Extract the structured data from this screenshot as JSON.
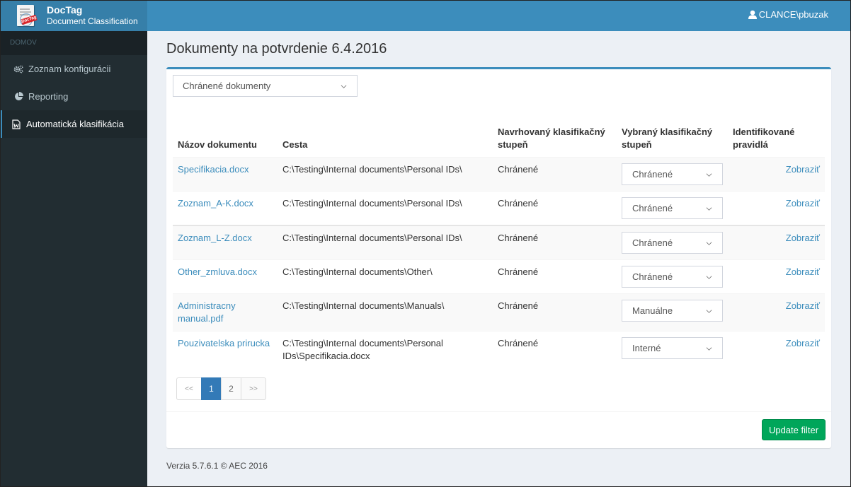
{
  "app": {
    "brand": "DocTag",
    "subtitle": "Document Classification",
    "logo_stamp": "DocTag"
  },
  "header": {
    "user": "CLANCE\\pbuzak",
    "user_icon": "user-icon"
  },
  "sidebar": {
    "section": "DOMOV",
    "items": [
      {
        "label": "Zoznam konfigurácii",
        "icon": "gears-icon",
        "active": false
      },
      {
        "label": "Reporting",
        "icon": "pie-chart-icon",
        "active": false
      },
      {
        "label": "Automatická klasifikácia",
        "icon": "word-file-icon",
        "active": true
      }
    ]
  },
  "page": {
    "title": "Dokumenty na potvrdenie 6.4.2016"
  },
  "filter": {
    "selected": "Chránené dokumenty"
  },
  "table": {
    "headers": {
      "name": "Názov dokumentu",
      "path": "Cesta",
      "proposed_line1": "Navrhovaný klasifikačný",
      "proposed_line2": "stupeň",
      "selected_line1": "Vybraný klasifikačný",
      "selected_line2": "stupeň",
      "rules_line1": "Identifikované",
      "rules_line2": "pravidlá"
    },
    "rows": [
      {
        "name": "Specifikacia.docx",
        "path": "C:\\Testing\\Internal documents\\Personal IDs\\",
        "proposed": "Chránené",
        "selected": "Chránené",
        "action": "Zobraziť"
      },
      {
        "name": "Zoznam_A-K.docx",
        "path": "C:\\Testing\\Internal documents\\Personal IDs\\",
        "proposed": "Chránené",
        "selected": "Chránené",
        "action": "Zobraziť"
      },
      {
        "name": "Zoznam_L-Z.docx",
        "path": "C:\\Testing\\Internal documents\\Personal IDs\\",
        "proposed": "Chránené",
        "selected": "Chránené",
        "action": "Zobraziť"
      },
      {
        "name": "Other_zmluva.docx",
        "path": "C:\\Testing\\Internal documents\\Other\\",
        "proposed": "Chránené",
        "selected": "Chránené",
        "action": "Zobraziť"
      },
      {
        "name": "Administracny manual.pdf",
        "path": "C:\\Testing\\Internal documents\\Manuals\\",
        "proposed": "Chránené",
        "selected": "Manuálne",
        "action": "Zobraziť"
      },
      {
        "name": "Pouzivatelska prirucka",
        "path": "C:\\Testing\\Internal documents\\Personal IDs\\Specifikacia.docx",
        "proposed": "Chránené",
        "selected": "Interné",
        "action": "Zobraziť"
      }
    ]
  },
  "pagination": {
    "prev": "<<",
    "pages": [
      "1",
      "2"
    ],
    "current": "1",
    "next": ">>"
  },
  "actions": {
    "update_filter": "Update filter"
  },
  "footer": {
    "version": "Verzia 5.7.6.1 © AEC 2016"
  },
  "colors": {
    "primary": "#3c8dbc",
    "sidebar_bg": "#222d32",
    "success": "#00a65a",
    "link": "#3c8dbc"
  }
}
